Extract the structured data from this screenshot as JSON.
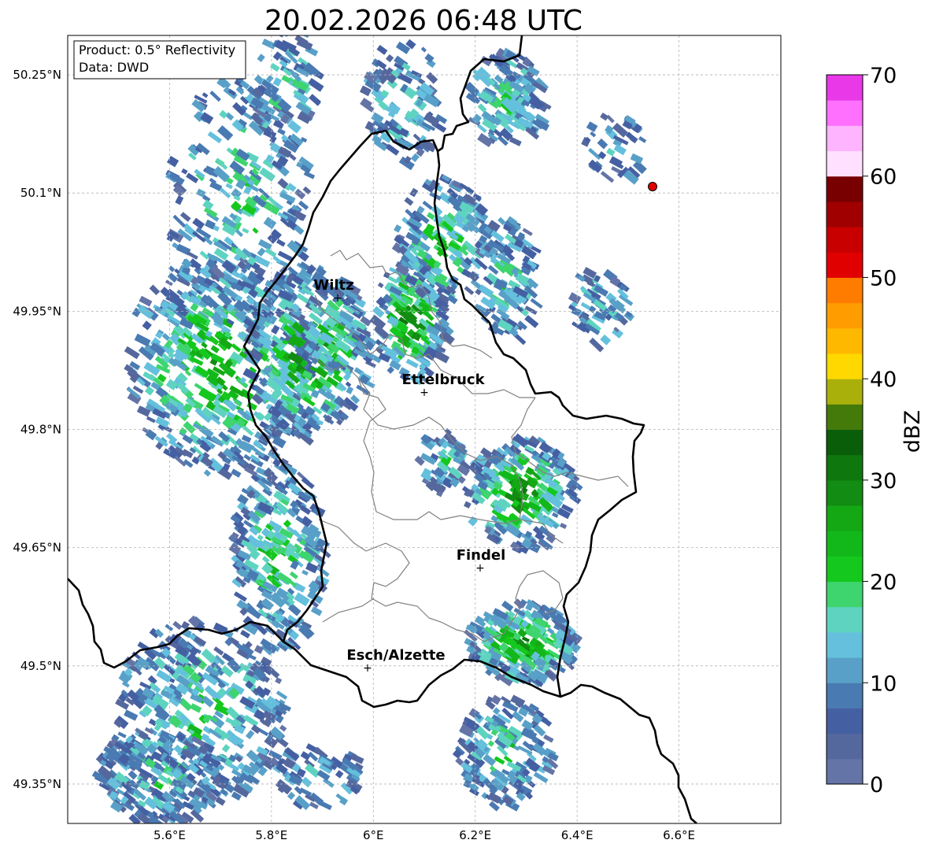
{
  "title": "20.02.2026 06:48 UTC",
  "info_box": {
    "product": "Product: 0.5° Reflectivity",
    "data": "Data: DWD"
  },
  "map": {
    "lon_range": [
      5.4,
      6.8
    ],
    "lat_range": [
      49.3,
      50.3
    ],
    "lon_ticks": [
      {
        "value": 5.6,
        "label": "5.6°E"
      },
      {
        "value": 5.8,
        "label": "5.8°E"
      },
      {
        "value": 6.0,
        "label": "6°E"
      },
      {
        "value": 6.2,
        "label": "6.2°E"
      },
      {
        "value": 6.4,
        "label": "6.4°E"
      },
      {
        "value": 6.6,
        "label": "6.6°E"
      }
    ],
    "lat_ticks": [
      {
        "value": 50.25,
        "label": "50.25°N"
      },
      {
        "value": 50.1,
        "label": "50.1°N"
      },
      {
        "value": 49.95,
        "label": "49.95°N"
      },
      {
        "value": 49.8,
        "label": "49.8°N"
      },
      {
        "value": 49.65,
        "label": "49.65°N"
      },
      {
        "value": 49.5,
        "label": "49.5°N"
      },
      {
        "value": 49.35,
        "label": "49.35°N"
      }
    ],
    "grid": true,
    "cities": [
      {
        "name": "Wiltz",
        "lon": 5.93,
        "lat": 49.966
      },
      {
        "name": "Ettelbruck",
        "lon": 6.1,
        "lat": 49.847
      },
      {
        "name": "Findel",
        "lon": 6.21,
        "lat": 49.627
      },
      {
        "name": "Esch/Alzette",
        "lon": 5.99,
        "lat": 49.5
      }
    ],
    "radar_site": {
      "lon": 6.548,
      "lat": 50.109,
      "color": "#e00000"
    }
  },
  "colorbar": {
    "label": "dBZ",
    "min": 0,
    "max": 70,
    "ticks": [
      "0",
      "10",
      "20",
      "30",
      "40",
      "50",
      "60",
      "70"
    ],
    "colors": [
      "#6474a6",
      "#55689e",
      "#4560a2",
      "#4a7ab2",
      "#58a0c8",
      "#64c0dc",
      "#5ed4c0",
      "#3ed46e",
      "#14c81e",
      "#12b81a",
      "#14a814",
      "#128c12",
      "#0e780e",
      "#0a5e0a",
      "#447a0a",
      "#aab00a",
      "#ffd800",
      "#ffb800",
      "#ff9c00",
      "#ff7c00",
      "#e00000",
      "#c80000",
      "#a00000",
      "#780000",
      "#ffe0ff",
      "#ffb4ff",
      "#ff70ff",
      "#e838e8"
    ]
  }
}
